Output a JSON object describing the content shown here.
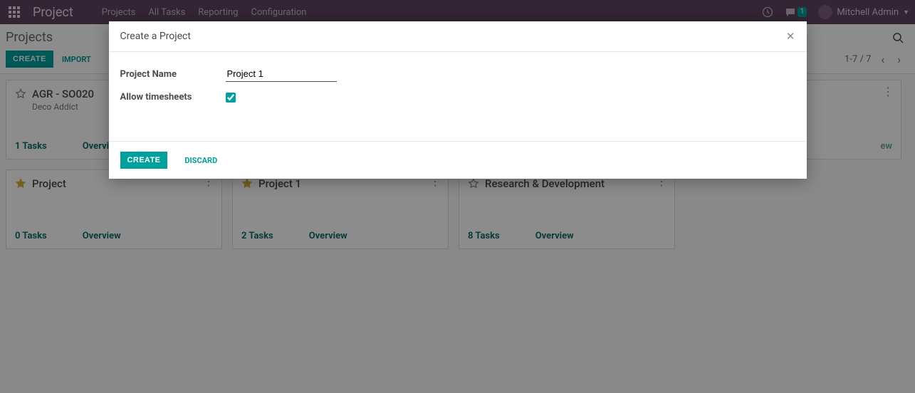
{
  "nav": {
    "brand": "Project",
    "items": [
      "Projects",
      "All Tasks",
      "Reporting",
      "Configuration"
    ],
    "chat_count": "1",
    "user_name": "Mitchell Admin"
  },
  "control": {
    "breadcrumb": "Projects",
    "create_label": "CREATE",
    "import_label": "IMPORT",
    "pager": "1-7 / 7"
  },
  "cards": [
    {
      "title": "AGR - SO020",
      "subtitle": "Deco Addict",
      "tasks": "1",
      "favorite": false
    },
    {
      "title": "Project",
      "subtitle": "",
      "tasks": "0",
      "favorite": true
    },
    {
      "title": "Project 1",
      "subtitle": "",
      "tasks": "2",
      "favorite": true
    },
    {
      "title": "Research & Development",
      "subtitle": "",
      "tasks": "8",
      "favorite": false
    }
  ],
  "card_labels": {
    "tasks_suffix": " Tasks",
    "overview": "Overview"
  },
  "modal": {
    "title": "Create a Project",
    "field_name_label": "Project Name",
    "field_name_value": "Project 1",
    "field_timesheets_label": "Allow timesheets",
    "field_timesheets_checked": true,
    "create_label": "CREATE",
    "discard_label": "DISCARD"
  },
  "colors": {
    "teal": "#00a09d",
    "purple": "#5d445d"
  }
}
